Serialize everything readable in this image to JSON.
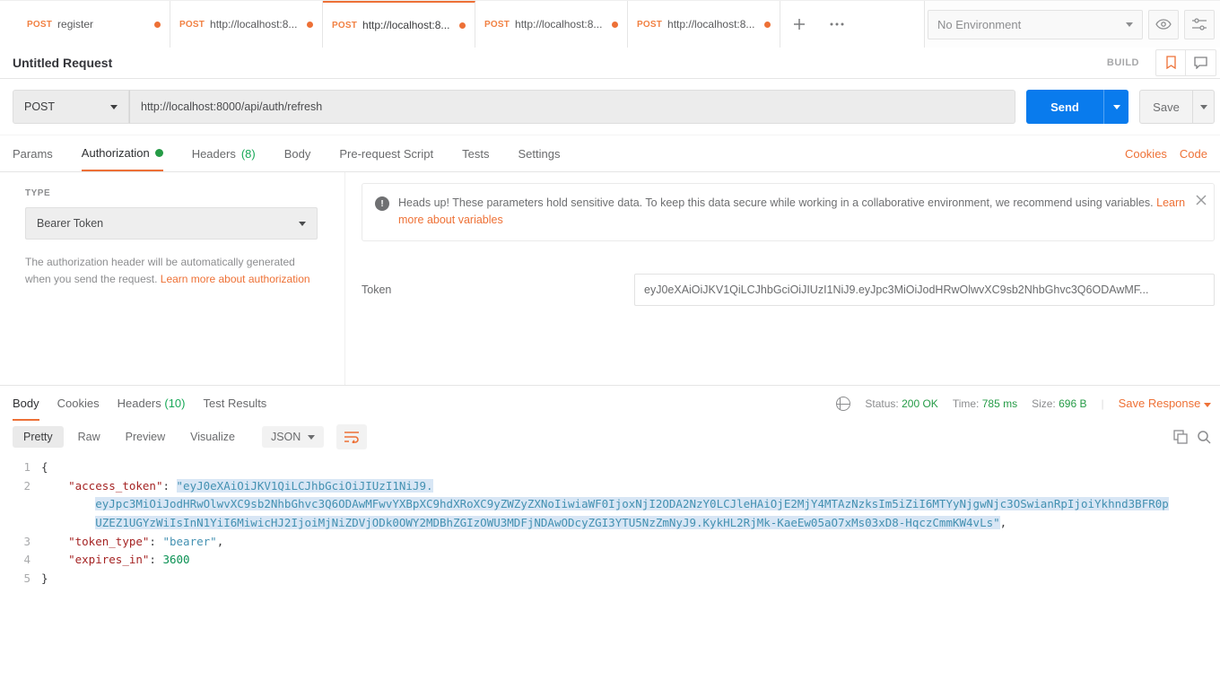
{
  "environment": {
    "selected": "No Environment"
  },
  "tabs": [
    {
      "method_label": "POST",
      "label": "register"
    },
    {
      "method_label": "POST",
      "label": "http://localhost:8..."
    },
    {
      "method_label": "POST",
      "label": "http://localhost:8..."
    },
    {
      "method_label": "POST",
      "label": "http://localhost:8..."
    },
    {
      "method_label": "POST",
      "label": "http://localhost:8..."
    }
  ],
  "request": {
    "title": "Untitled Request",
    "build_label": "BUILD",
    "method": "POST",
    "url": "http://localhost:8000/api/auth/refresh",
    "send_label": "Send",
    "save_label": "Save"
  },
  "req_tabs": {
    "params": "Params",
    "authorization": "Authorization",
    "headers": "Headers",
    "headers_count": "(8)",
    "body": "Body",
    "prereq": "Pre-request Script",
    "tests": "Tests",
    "settings": "Settings",
    "cookies": "Cookies",
    "code": "Code"
  },
  "auth": {
    "type_label": "TYPE",
    "type_value": "Bearer Token",
    "desc_a": "The authorization header will be automatically generated when you send the request. ",
    "desc_link": "Learn more about authorization",
    "notice_a": "Heads up! These parameters hold sensitive data. To keep this data secure while working in a collaborative environment, we recommend using variables. ",
    "notice_link": "Learn more about variables",
    "token_label": "Token",
    "token_value": "eyJ0eXAiOiJKV1QiLCJhbGciOiJIUzI1NiJ9.eyJpc3MiOiJodHRwOlwvXC9sb2NhbGhvc3Q6ODAwMF..."
  },
  "response": {
    "tabs": {
      "body": "Body",
      "cookies": "Cookies",
      "headers": "Headers",
      "headers_count": "(10)",
      "test_results": "Test Results"
    },
    "status_label": "Status:",
    "status_value": "200 OK",
    "time_label": "Time:",
    "time_value": "785 ms",
    "size_label": "Size:",
    "size_value": "696 B",
    "save_response": "Save Response",
    "toolbar": {
      "pretty": "Pretty",
      "raw": "Raw",
      "preview": "Preview",
      "visualize": "Visualize",
      "format": "JSON"
    },
    "json": {
      "l2key": "\"access_token\"",
      "l2val_a": "\"eyJ0eXAiOiJKV1QiLCJhbGciOiJIUzI1NiJ9.",
      "l2val_b": "eyJpc3MiOiJodHRwOlwvXC9sb2NhbGhvc3Q6ODAwMFwvYXBpXC9hdXRoXC9yZWZyZXNoIiwiaWF0IjoxNjI2ODA2NzY0LCJleHAiOjE2MjY4MTAzNzksIm5iZiI6MTYyNjgwNjc3OSwianRpIjoiYkhnd3BFR0p",
      "l2val_c": "UZEZ1UGYzWiIsInN1YiI6MiwicHJ2IjoiMjNiZDVjODk0OWY2MDBhZGIzOWU3MDFjNDAwODcyZGI3YTU5NzZmNyJ9.KykHL2RjMk-KaeEw05aO7xMs03xD8-HqczCmmKW4vLs\"",
      "l3key": "\"token_type\"",
      "l3val": "\"bearer\"",
      "l4key": "\"expires_in\"",
      "l4val": "3600"
    }
  }
}
